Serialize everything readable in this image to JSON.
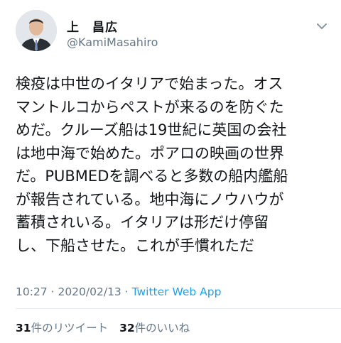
{
  "author": {
    "display_name": "上　昌広",
    "handle": "@KamiMasahiro",
    "avatar_icon": "person-avatar"
  },
  "tweet": {
    "lines": [
      "検疫は中世のイタリアで始まった。オス",
      "マントルコからペストが来るのを防ぐた",
      "めだ。クルーズ船は19世紀に英国の会社",
      "は地中海で始めた。ポアロの映画の世界",
      "だ。PUBMEDを調べると多数の船内艦船",
      "が報告されている。地中海にノウハウが",
      "蓄積されいる。イタリアは形だけ停留",
      "し、下船させた。これが手慣れただ"
    ]
  },
  "meta": {
    "time": "10:27",
    "separator": " · ",
    "date": "2020/02/13",
    "app": "Twitter Web App"
  },
  "stats": {
    "retweets_count": "31",
    "retweets_label": "件のリツイート",
    "likes_count": "32",
    "likes_label": "件のいいね"
  },
  "colors": {
    "text": "#14171a",
    "secondary": "#657786",
    "link": "#1da1f2",
    "divider": "#e6ecf0"
  }
}
